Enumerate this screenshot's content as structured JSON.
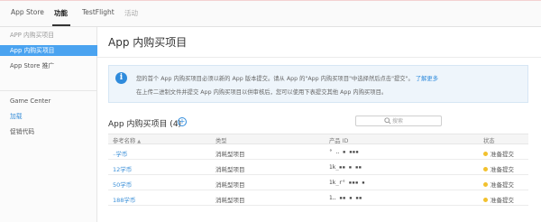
{
  "top_tabs": [
    {
      "label": "App Store",
      "active": false,
      "dim": false
    },
    {
      "label": "功能",
      "active": true,
      "dim": false
    },
    {
      "label": "TestFlight",
      "active": false,
      "dim": false
    },
    {
      "label": "活动",
      "active": false,
      "dim": true
    }
  ],
  "sidebar": {
    "section_header": "APP 内购买项目",
    "items": [
      {
        "label": "App 内购买项目",
        "selected": true
      },
      {
        "label": "App Store 推广",
        "selected": false
      }
    ],
    "secondary": [
      {
        "label": "Game Center"
      },
      {
        "label": "加载"
      },
      {
        "label": "促销代码"
      }
    ]
  },
  "page": {
    "title": "App 内购买项目",
    "notice": {
      "icon": "info-icon",
      "line1": "您的首个 App 内购买项目必须以新的 App 版本提交。请从 App 的\"App 内购买项目\"中选择然后点击\"提交\"。",
      "link": "了解更多",
      "line2": "在上传二进制文件并提交 App 内购买项目以供审核后，您可以使用下表提交其他 App 内购买项目。"
    },
    "list_title": "App 内购买项目 (4)",
    "add_symbol": "+",
    "search": {
      "placeholder": "搜索",
      "value": ""
    }
  },
  "table": {
    "headers": {
      "name": "参考名称",
      "sort": "▲",
      "type": "类型",
      "product_id": "产品 ID",
      "status": "状态"
    },
    "rows": [
      {
        "name": "₋学币",
        "type": "消耗型项目",
        "product_id": "° ‥ ▪ ▪▪▪",
        "status": "准备提交"
      },
      {
        "name": "12学币",
        "type": "消耗型项目",
        "product_id": "1k_▪▪  ▪ ▪▪",
        "status": "准备提交"
      },
      {
        "name": "50学币",
        "type": "消耗型项目",
        "product_id": "1k_r° ▪▪▪ ▪",
        "status": "准备提交"
      },
      {
        "name": "188学币",
        "type": "消耗型项目",
        "product_id": "1‥ ▪▪ ▪  ▪▪",
        "status": "准备提交"
      }
    ],
    "status_color": "#f2c12e"
  },
  "colors": {
    "accent": "#4aa3f0",
    "link": "#2f8bdc"
  }
}
